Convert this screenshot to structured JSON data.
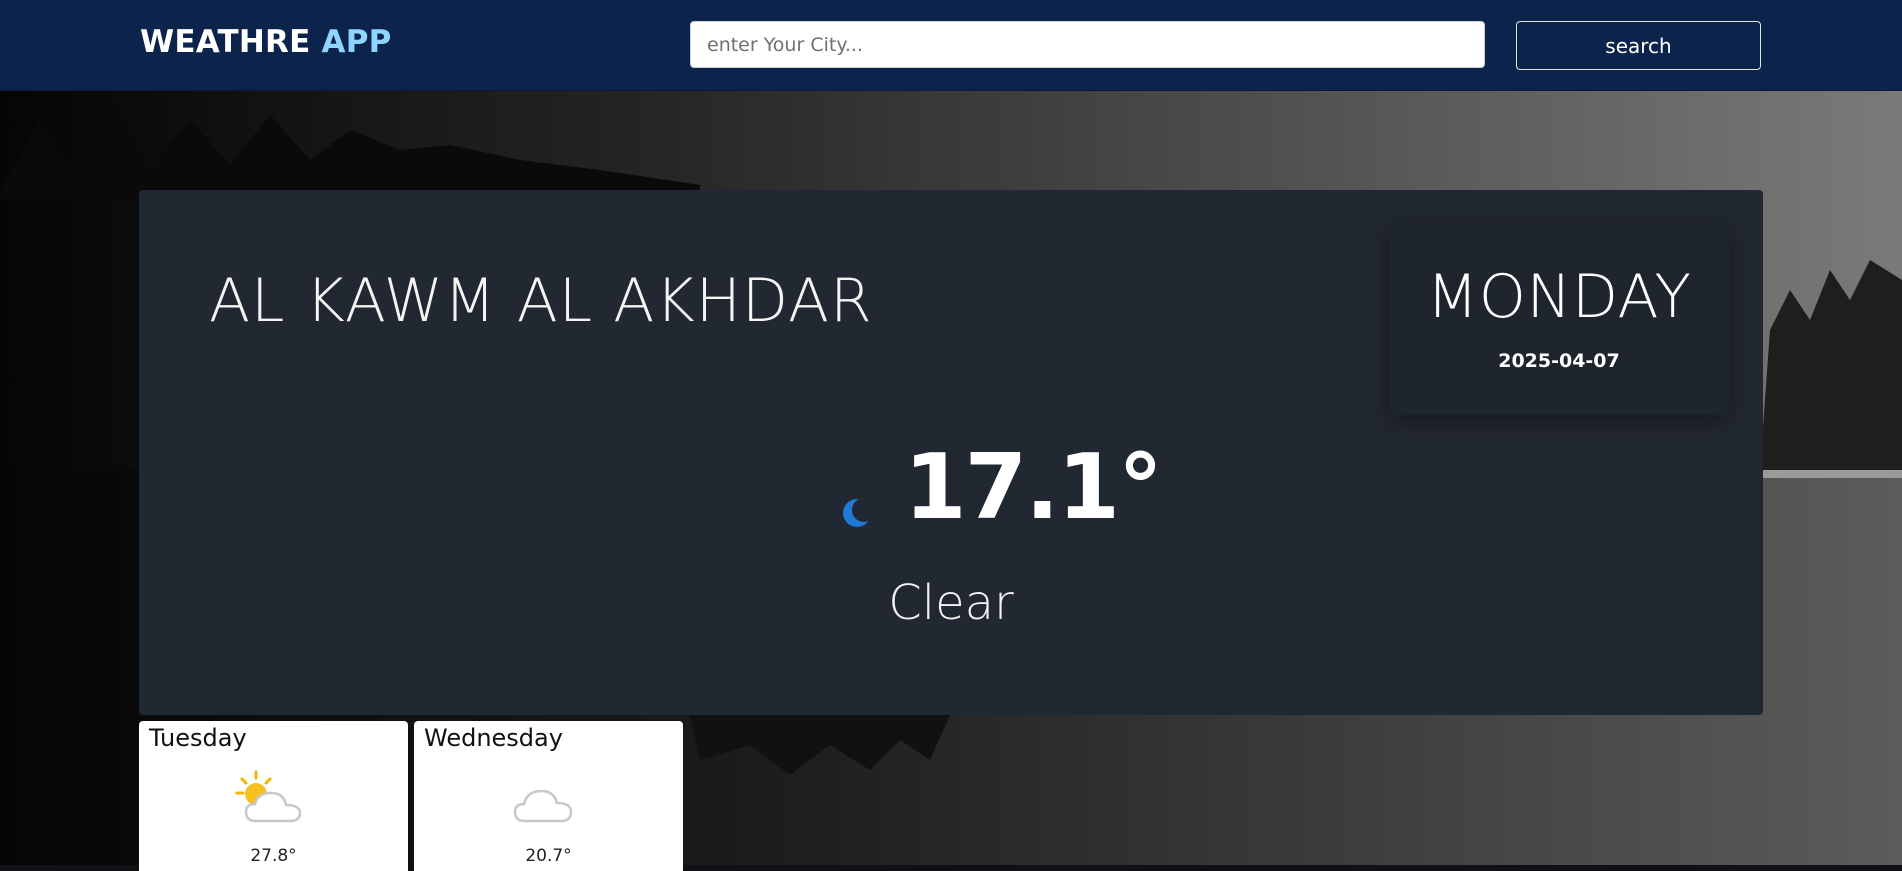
{
  "header": {
    "brand_main": "WEATHRE",
    "brand_accent": "APP",
    "search_placeholder": "enter Your City...",
    "search_label": "search"
  },
  "current": {
    "city": "AL KAWM AL AKHDAR",
    "day": "MONDAY",
    "date": "2025-04-07",
    "temperature": "17.1°",
    "condition": "Clear",
    "icon": "moon-icon"
  },
  "forecast": [
    {
      "day": "Tuesday",
      "temperature": "27.8°",
      "icon": "partly-sunny-icon"
    },
    {
      "day": "Wednesday",
      "temperature": "20.7°",
      "icon": "cloud-icon"
    }
  ],
  "colors": {
    "navbar": "#0c234b",
    "brand_accent": "#8fd3ff",
    "card": "#222831",
    "moon": "#1e7ad6"
  }
}
